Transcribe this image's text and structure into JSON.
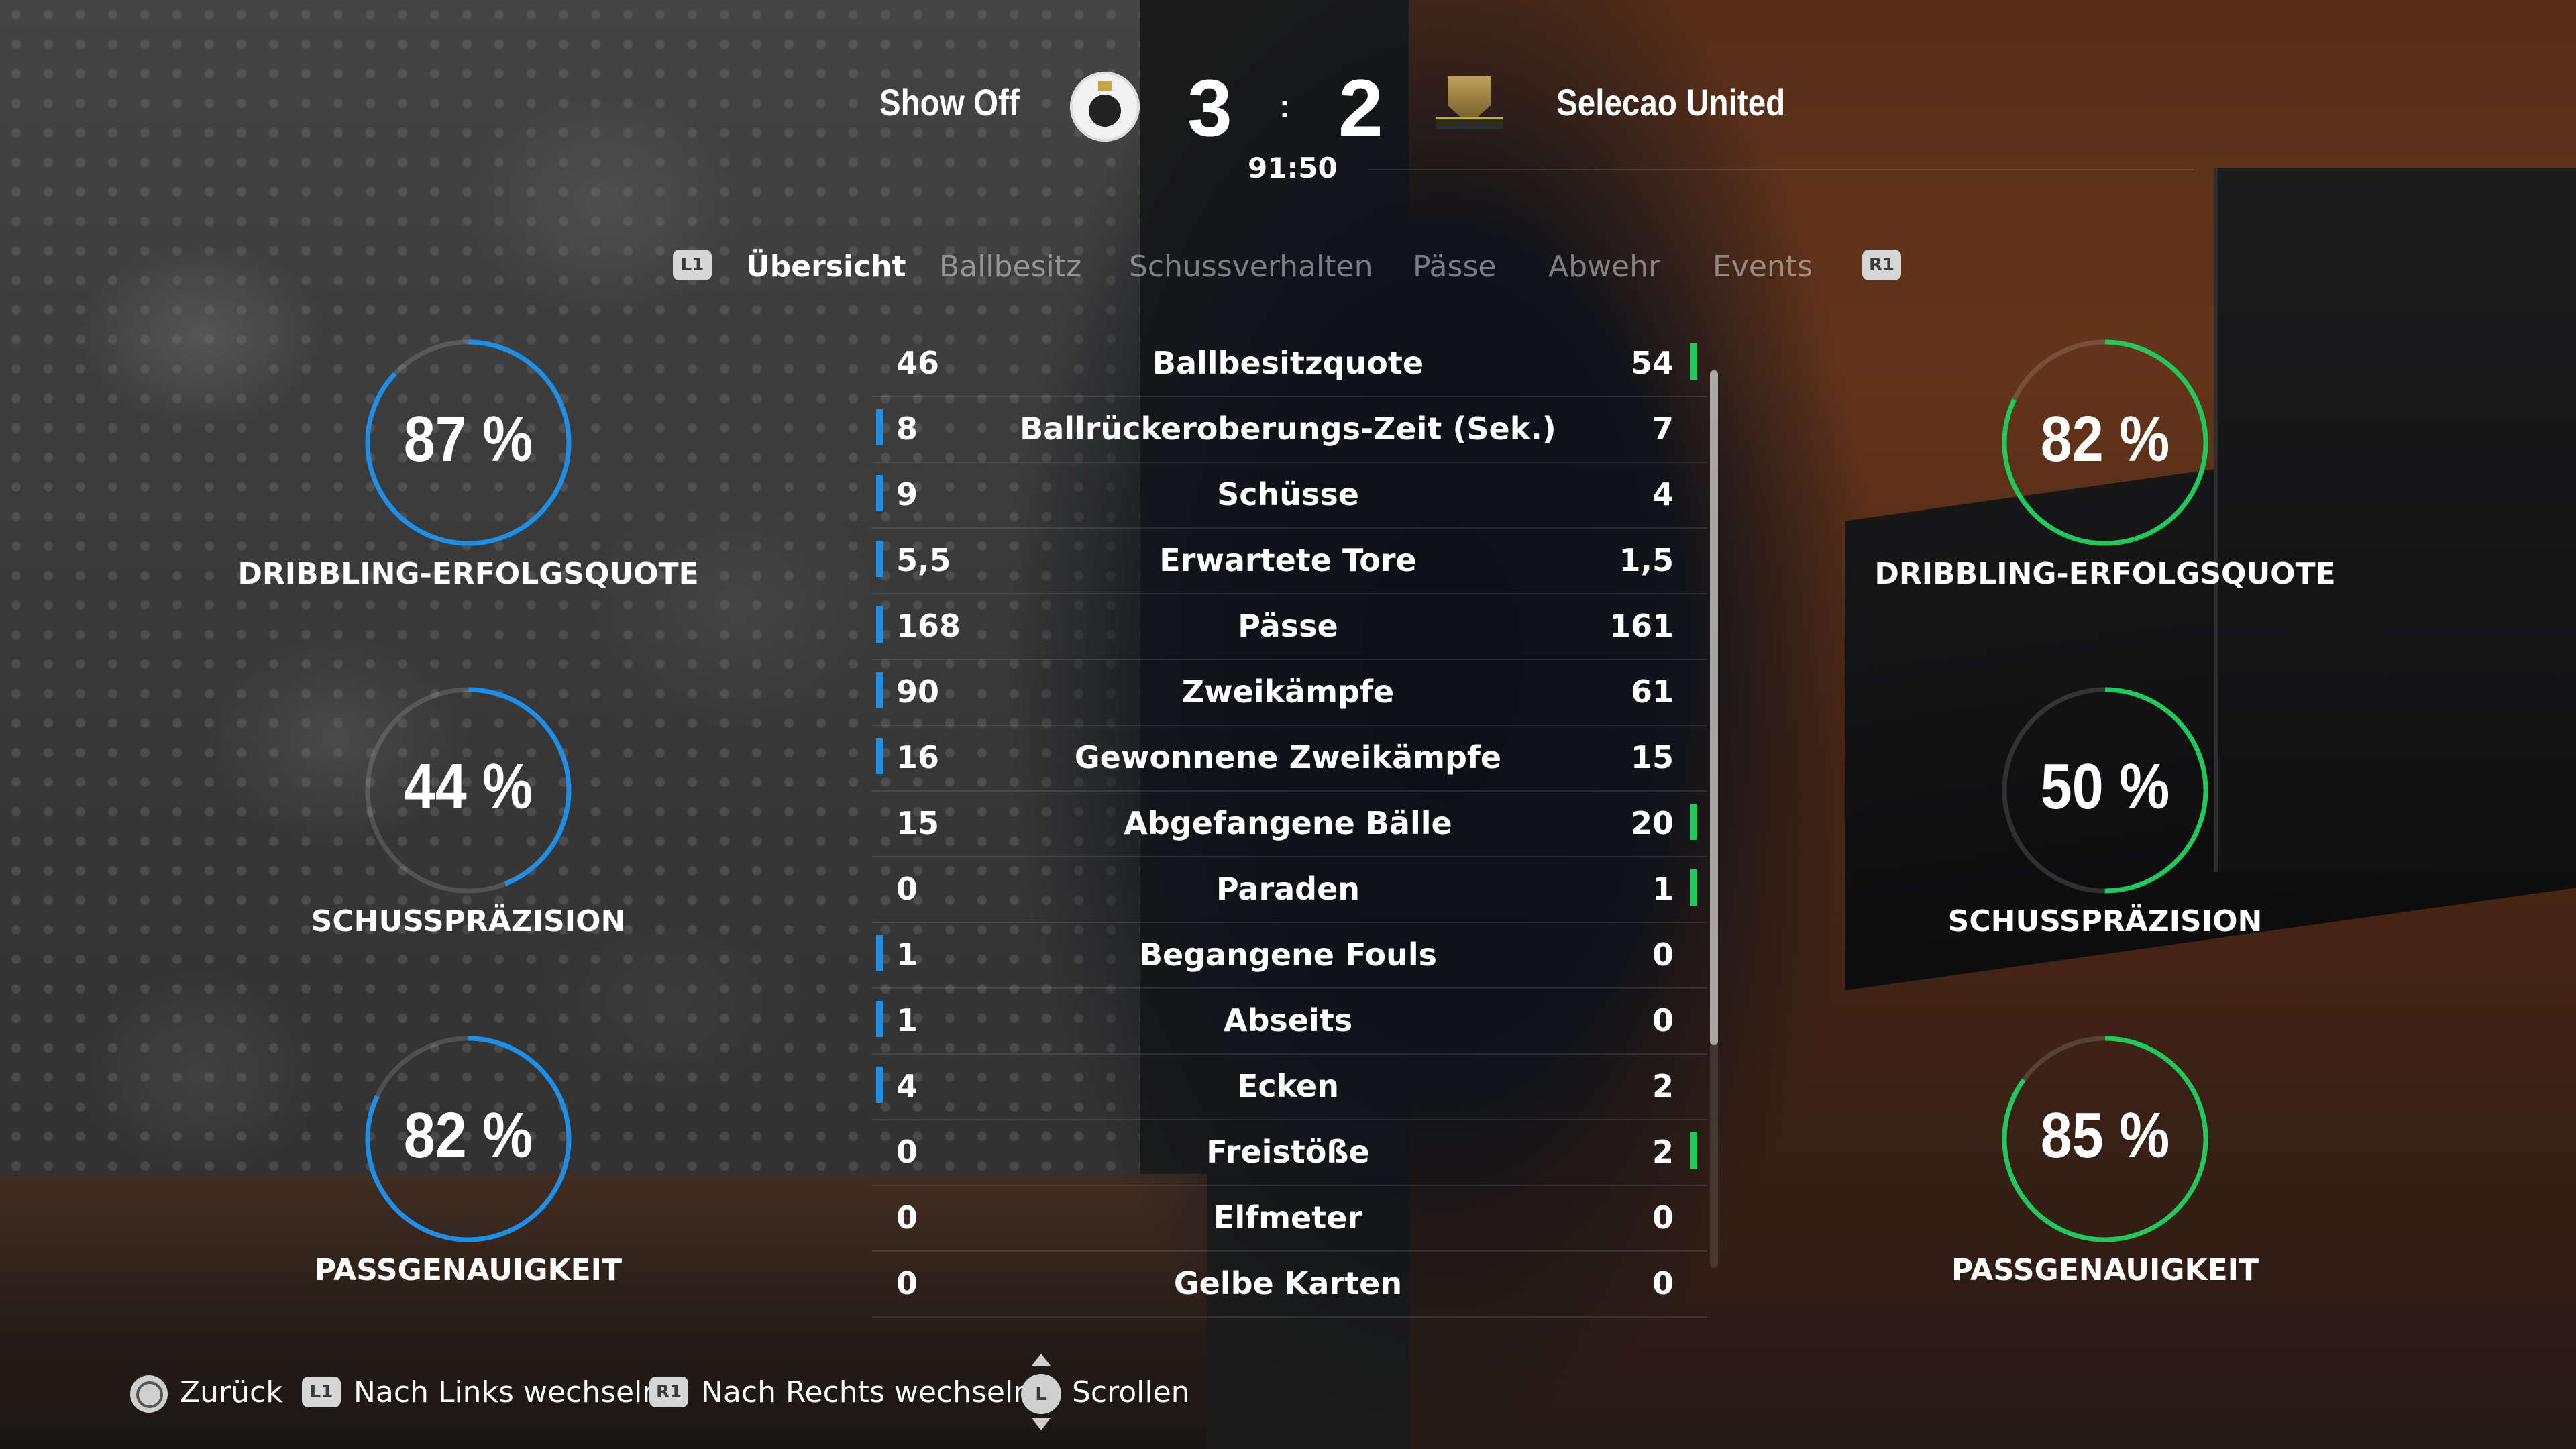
{
  "colors": {
    "home_accent": "#1e8fe8",
    "away_accent": "#21c95c"
  },
  "match": {
    "home_team": "Show Off",
    "away_team": "Selecao United",
    "home_score": "3",
    "separator": ":",
    "away_score": "2",
    "clock": "91:50"
  },
  "tabs": {
    "left_button": "L1",
    "right_button": "R1",
    "items": [
      "Übersicht",
      "Ballbesitz",
      "Schussverhalten",
      "Pässe",
      "Abwehr",
      "Events"
    ]
  },
  "stats": [
    {
      "label": "Ballbesitzquote",
      "home": "46",
      "away": "54",
      "leader": "away"
    },
    {
      "label": "Ballrückeroberungs-Zeit (Sek.)",
      "home": "8",
      "away": "7",
      "leader": "home"
    },
    {
      "label": "Schüsse",
      "home": "9",
      "away": "4",
      "leader": "home"
    },
    {
      "label": "Erwartete Tore",
      "home": "5,5",
      "away": "1,5",
      "leader": "home"
    },
    {
      "label": "Pässe",
      "home": "168",
      "away": "161",
      "leader": "home"
    },
    {
      "label": "Zweikämpfe",
      "home": "90",
      "away": "61",
      "leader": "home"
    },
    {
      "label": "Gewonnene Zweikämpfe",
      "home": "16",
      "away": "15",
      "leader": "home"
    },
    {
      "label": "Abgefangene Bälle",
      "home": "15",
      "away": "20",
      "leader": "away"
    },
    {
      "label": "Paraden",
      "home": "0",
      "away": "1",
      "leader": "away"
    },
    {
      "label": "Begangene Fouls",
      "home": "1",
      "away": "0",
      "leader": "home"
    },
    {
      "label": "Abseits",
      "home": "1",
      "away": "0",
      "leader": "home"
    },
    {
      "label": "Ecken",
      "home": "4",
      "away": "2",
      "leader": "home"
    },
    {
      "label": "Freistöße",
      "home": "0",
      "away": "2",
      "leader": "away"
    },
    {
      "label": "Elfmeter",
      "home": "0",
      "away": "0",
      "leader": "none"
    },
    {
      "label": "Gelbe Karten",
      "home": "0",
      "away": "0",
      "leader": "none"
    }
  ],
  "home_rings": [
    {
      "value": "87 %",
      "percent": 87,
      "label": "DRIBBLING-ERFOLGSQUOTE"
    },
    {
      "value": "44 %",
      "percent": 44,
      "label": "SCHUSSPRÄZISION"
    },
    {
      "value": "82 %",
      "percent": 82,
      "label": "PASSGENAUIGKEIT"
    }
  ],
  "away_rings": [
    {
      "value": "82 %",
      "percent": 82,
      "label": "DRIBBLING-ERFOLGSQUOTE"
    },
    {
      "value": "50 %",
      "percent": 50,
      "label": "SCHUSSPRÄZISION"
    },
    {
      "value": "85 %",
      "percent": 85,
      "label": "PASSGENAUIGKEIT"
    }
  ],
  "footer": {
    "back": "Zurück",
    "l1": "L1",
    "switch_left": "Nach Links wechseln",
    "r1": "R1",
    "switch_right": "Nach Rechts wechseln",
    "stick": "L",
    "scroll": "Scrollen"
  }
}
